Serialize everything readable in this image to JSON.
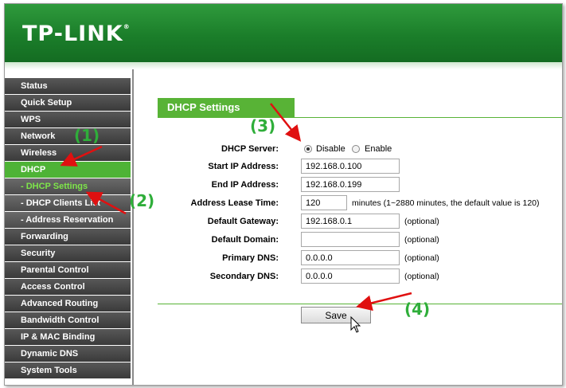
{
  "brand": {
    "logo": "TP-LINK",
    "trademark": "®"
  },
  "sidebar": {
    "items": [
      {
        "label": "Status",
        "state": "normal"
      },
      {
        "label": "Quick Setup",
        "state": "normal"
      },
      {
        "label": "WPS",
        "state": "normal"
      },
      {
        "label": "Network",
        "state": "normal"
      },
      {
        "label": "Wireless",
        "state": "normal"
      },
      {
        "label": "DHCP",
        "state": "active"
      },
      {
        "label": "- DHCP Settings",
        "state": "sub-active"
      },
      {
        "label": "- DHCP Clients List",
        "state": "sub"
      },
      {
        "label": "- Address Reservation",
        "state": "sub"
      },
      {
        "label": "Forwarding",
        "state": "normal"
      },
      {
        "label": "Security",
        "state": "normal"
      },
      {
        "label": "Parental Control",
        "state": "normal"
      },
      {
        "label": "Access Control",
        "state": "normal"
      },
      {
        "label": "Advanced Routing",
        "state": "normal"
      },
      {
        "label": "Bandwidth Control",
        "state": "normal"
      },
      {
        "label": "IP & MAC Binding",
        "state": "normal"
      },
      {
        "label": "Dynamic DNS",
        "state": "normal"
      },
      {
        "label": "System Tools",
        "state": "normal"
      }
    ]
  },
  "main": {
    "section_title": "DHCP Settings",
    "dhcp_server": {
      "label": "DHCP Server:",
      "options": [
        "Disable",
        "Enable"
      ],
      "selected": "Disable"
    },
    "start_ip": {
      "label": "Start IP Address:",
      "value": "192.168.0.100"
    },
    "end_ip": {
      "label": "End IP Address:",
      "value": "192.168.0.199"
    },
    "lease_time": {
      "label": "Address Lease Time:",
      "value": "120",
      "hint": "minutes (1~2880 minutes, the default value is 120)"
    },
    "gateway": {
      "label": "Default Gateway:",
      "value": "192.168.0.1",
      "hint": "(optional)"
    },
    "domain": {
      "label": "Default Domain:",
      "value": "",
      "hint": "(optional)"
    },
    "primary_dns": {
      "label": "Primary DNS:",
      "value": "0.0.0.0",
      "hint": "(optional)"
    },
    "secondary_dns": {
      "label": "Secondary DNS:",
      "value": "0.0.0.0",
      "hint": "(optional)"
    },
    "save_label": "Save"
  },
  "annotations": {
    "step1": "(1)",
    "step2": "(2)",
    "step3": "(3)",
    "step4": "(4)"
  },
  "colors": {
    "brand_green": "#1b7e2a",
    "accent_green": "#58b336",
    "annotation_green": "#2fae3a",
    "arrow_red": "#e01010",
    "nav_dark": "#3a3a3a"
  },
  "icons": {
    "cursor": "mouse-pointer-icon",
    "arrow": "red-arrow-icon"
  }
}
